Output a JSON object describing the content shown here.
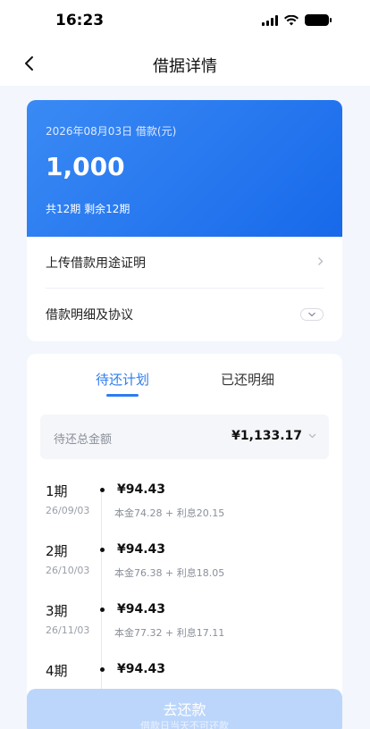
{
  "status_bar": {
    "time": "16:23"
  },
  "nav": {
    "title": "借据详情"
  },
  "loan": {
    "date_label": "2026年08月03日 借款(元)",
    "amount": "1,000",
    "periods": "共12期  剩余12期",
    "rows": [
      {
        "label": "上传借款用途证明"
      },
      {
        "label": "借款明细及协议"
      }
    ]
  },
  "plan": {
    "tabs": [
      {
        "label": "待还计划",
        "active": true
      },
      {
        "label": "已还明细",
        "active": false
      }
    ],
    "total_label": "待还总金额",
    "total_value": "¥1,133.17",
    "items": [
      {
        "period": "1期",
        "date": "26/09/03",
        "amount": "¥94.43",
        "detail": "本金74.28 + 利息20.15"
      },
      {
        "period": "2期",
        "date": "26/10/03",
        "amount": "¥94.43",
        "detail": "本金76.38 + 利息18.05"
      },
      {
        "period": "3期",
        "date": "26/11/03",
        "amount": "¥94.43",
        "detail": "本金77.32 + 利息17.11"
      },
      {
        "period": "4期",
        "date": "",
        "amount": "¥94.43",
        "detail": ""
      }
    ]
  },
  "repay_button": {
    "label": "去还款",
    "hint": "借款日当天不可还款"
  },
  "colors": {
    "accent": "#2d7cf0",
    "card_gradient_start": "#3a8af5",
    "card_gradient_end": "#1869ea",
    "button_disabled": "#bcd6fb"
  },
  "icons": [
    "back-icon",
    "signal-icon",
    "wifi-icon",
    "battery-icon",
    "chevron-right-icon",
    "chevron-down-icon"
  ]
}
